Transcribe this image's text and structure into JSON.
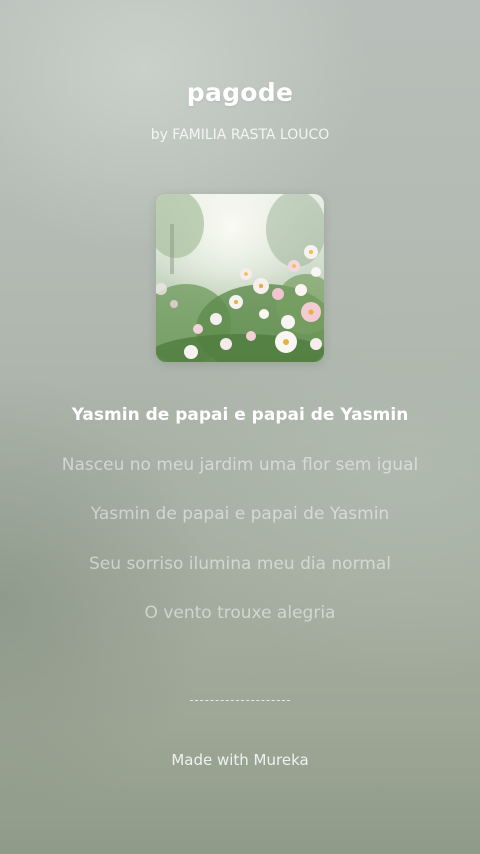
{
  "song": {
    "title": "pagode",
    "artist": "by FAMILIA RASTA LOUCO"
  },
  "cover": {
    "icon": "flower-garden-artwork"
  },
  "lyrics": [
    "Yasmin de papai e papai de Yasmin",
    "Nasceu no meu jardim uma flor sem igual",
    "Yasmin de papai e papai de Yasmin",
    "Seu sorriso ilumina meu dia normal",
    "O vento trouxe alegria"
  ],
  "active_lyric_index": 0,
  "footer": {
    "made_with": "Made with Mureka"
  },
  "colors": {
    "active_lyric": "#ffffff",
    "inactive_lyric": "rgba(255,255,255,0.5)"
  }
}
